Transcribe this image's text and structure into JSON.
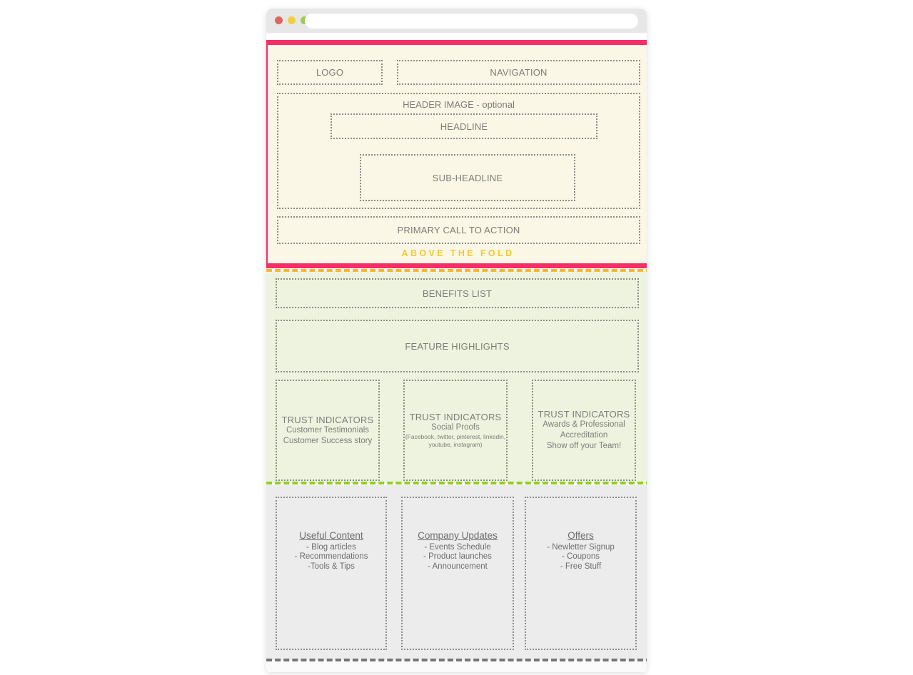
{
  "browser": {
    "traffic_lights": [
      {
        "name": "close",
        "color": "#e2635f"
      },
      {
        "name": "minimize",
        "color": "#f4cd45"
      },
      {
        "name": "maximize",
        "color": "#9fcb54"
      }
    ],
    "address_bar_value": "",
    "address_bar_placeholder": ""
  },
  "above_the_fold": {
    "caption": "ABOVE THE FOLD",
    "caption_color": "#f4c830",
    "outline_color": "#f72d68",
    "background": "#fbf7e6",
    "divider_color": "#f7b733",
    "logo": "LOGO",
    "navigation": "NAVIGATION",
    "header_image": "HEADER IMAGE - optional",
    "headline": "HEADLINE",
    "sub_headline": "SUB-HEADLINE",
    "call_to_action": "PRIMARY CALL TO ACTION"
  },
  "middle_section": {
    "background": "#eef3e0",
    "divider_color": "#8fd01f",
    "benefits_list": "BENEFITS LIST",
    "feature_highlights": "FEATURE HIGHLIGHTS",
    "trust_indicators": [
      {
        "title": "TRUST INDICATORS",
        "lines": [
          "Customer Testimonials",
          "Customer Success story"
        ],
        "note": ""
      },
      {
        "title": "TRUST INDICATORS",
        "lines": [
          "Social Proofs"
        ],
        "note": "(Facebook, twitter, pinterest, linkedin, youtube, instagram)"
      },
      {
        "title": "TRUST INDICATORS",
        "lines": [
          "Awards & Professional",
          "Accreditation",
          "Show off your Team!"
        ],
        "note": ""
      }
    ]
  },
  "bottom_section": {
    "background": "#ececec",
    "divider_color": "#757575",
    "columns": [
      {
        "heading": "Useful Content",
        "items": [
          "- Blog articles",
          "- Recommendations",
          "-Tools & Tips"
        ]
      },
      {
        "heading": "Company Updates",
        "items": [
          "- Events Schedule",
          "- Product launches",
          "- Announcement"
        ]
      },
      {
        "heading": "Offers",
        "items": [
          "- Newletter Signup",
          "- Coupons",
          "- Free Stuff"
        ]
      }
    ]
  }
}
